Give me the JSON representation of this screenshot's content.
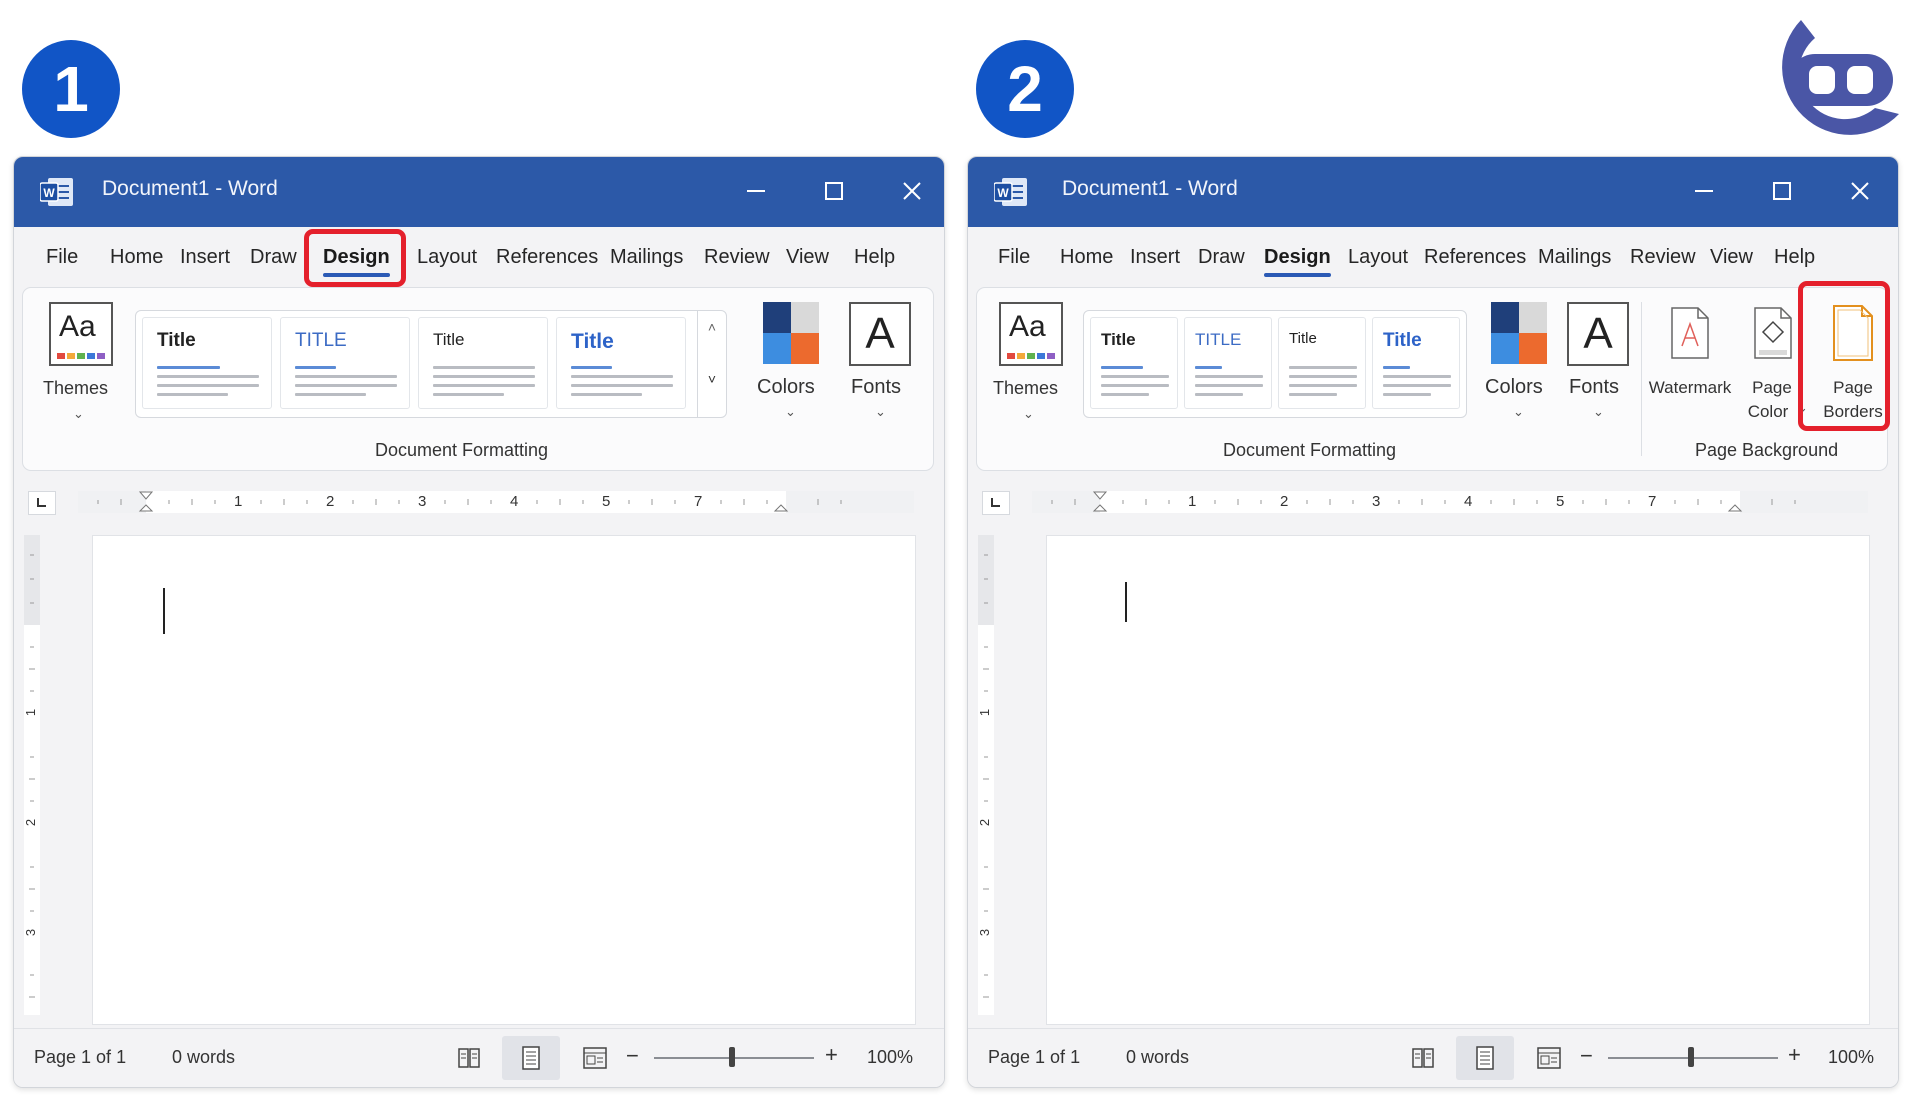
{
  "steps": [
    "1",
    "2"
  ],
  "windows": [
    {
      "app_title": "Document1  -  Word",
      "tabs": [
        "File",
        "Home",
        "Insert",
        "Draw",
        "Design",
        "Layout",
        "References",
        "Mailings",
        "Review",
        "View",
        "Help"
      ],
      "active_tab": "Design",
      "ribbon": {
        "themes_label": "Themes",
        "style_titles": [
          "Title",
          "TITLE",
          "Title",
          "Title"
        ],
        "colors_label": "Colors",
        "fonts_label": "Fonts",
        "fonts_glyph": "A",
        "group_label": "Document Formatting"
      },
      "ruler_numbers": [
        "1",
        "2",
        "3",
        "4",
        "5",
        "7"
      ],
      "status": {
        "page": "Page  1  of  1",
        "words": "0 words",
        "zoom": "100%",
        "zoom_minus": "−",
        "zoom_plus": "+"
      }
    },
    {
      "app_title": "Document1  -  Word",
      "tabs": [
        "File",
        "Home",
        "Insert",
        "Draw",
        "Design",
        "Layout",
        "References",
        "Mailings",
        "Review",
        "View",
        "Help"
      ],
      "active_tab": "Design",
      "ribbon": {
        "themes_label": "Themes",
        "style_titles": [
          "Title",
          "TITLE",
          "Title",
          "Title"
        ],
        "colors_label": "Colors",
        "fonts_label": "Fonts",
        "fonts_glyph": "A",
        "group_label": "Document Formatting",
        "watermark_label": "Watermark",
        "page_color_label_1": "Page",
        "page_color_label_2": "Color",
        "page_borders_label_1": "Page",
        "page_borders_label_2": "Borders",
        "page_background_label": "Page Background"
      },
      "ruler_numbers": [
        "1",
        "2",
        "3",
        "4",
        "5",
        "7"
      ],
      "status": {
        "page": "Page  1  of  1",
        "words": "0 words",
        "zoom": "100%",
        "zoom_minus": "−",
        "zoom_plus": "+"
      }
    }
  ],
  "vertical_ruler_numbers": [
    "1",
    "2",
    "3"
  ],
  "colors": {
    "title_bar": "#2c59a8",
    "highlight": "#e4202c",
    "step_badge": "#1155c6",
    "accent": "#2b5ab5"
  }
}
